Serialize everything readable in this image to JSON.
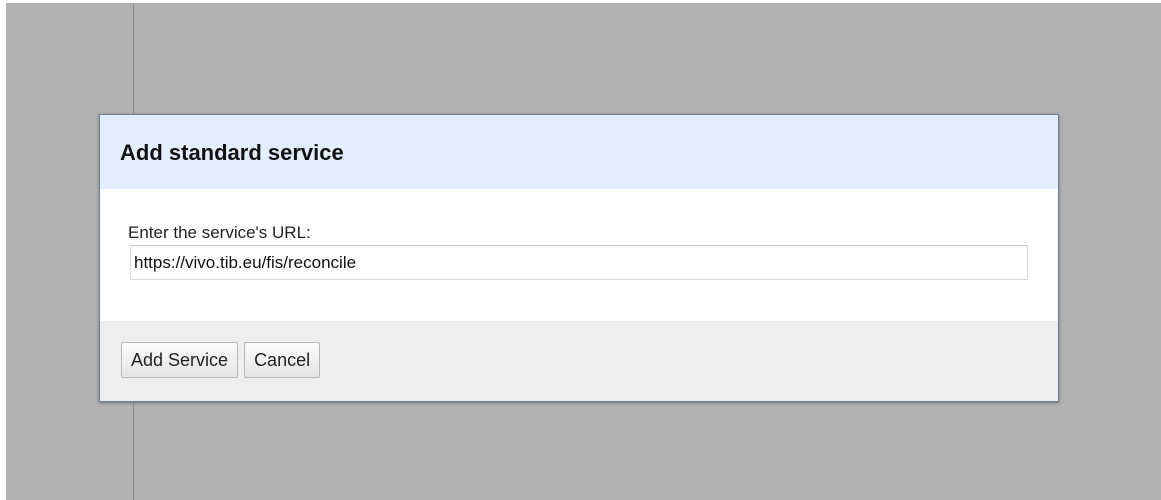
{
  "dialog": {
    "title": "Add standard service",
    "url_label": "Enter the service's URL:",
    "url_value": "https://vivo.tib.eu/fis/reconcile",
    "add_button_label": "Add Service",
    "cancel_button_label": "Cancel"
  },
  "colors": {
    "overlay": "#b1b1b1",
    "header_bg": "#e3edfc",
    "footer_bg": "#eeeeee",
    "dialog_border": "#6f7f93"
  }
}
